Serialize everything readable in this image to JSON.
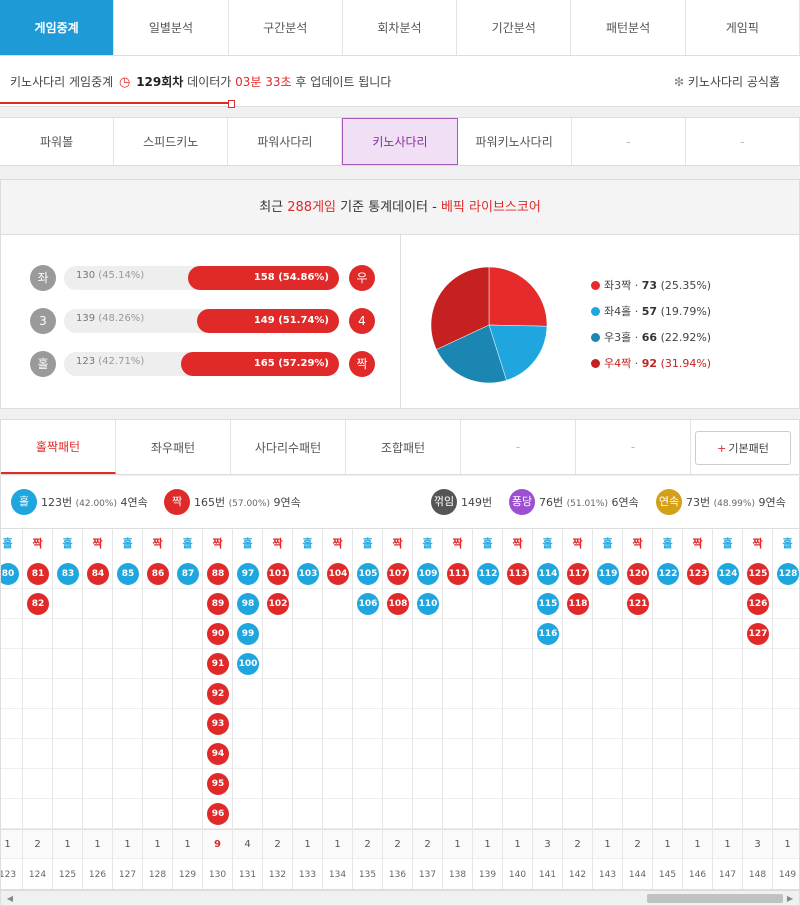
{
  "nav": {
    "tabs": [
      "게임중계",
      "일별분석",
      "구간분석",
      "회차분석",
      "기간분석",
      "패턴분석",
      "게임픽"
    ],
    "active": 0
  },
  "info": {
    "prefix": "키노사다리 게임중계",
    "round": "129회차",
    "mid": "데이터가",
    "time": "03분 33초",
    "suffix": "후 업데이트 됩니다",
    "official": "키노사다리 공식홈"
  },
  "games": {
    "tabs": [
      "파워볼",
      "스피드키노",
      "파워사다리",
      "키노사다리",
      "파워키노사다리",
      "-",
      "-"
    ],
    "active": 3
  },
  "stats": {
    "head_pre": "최근",
    "games": "288게임",
    "head_mid": "기준 통계데이터 -",
    "brand": "베픽 라이브스코어",
    "bars": [
      {
        "left": "좌",
        "right": "우",
        "left_val": "130",
        "left_pct": "(45.14%)",
        "right_text": "158 (54.86%)",
        "right_frac": 0.5486
      },
      {
        "left": "3",
        "right": "4",
        "left_val": "139",
        "left_pct": "(48.26%)",
        "right_text": "149 (51.74%)",
        "right_frac": 0.5174
      },
      {
        "left": "홀",
        "right": "짝",
        "left_val": "123",
        "left_pct": "(42.71%)",
        "right_text": "165 (57.29%)",
        "right_frac": 0.5729
      }
    ],
    "legend": [
      {
        "label": "좌3짝",
        "value": "73",
        "pct": "(25.35%)",
        "color": "#e52b2b"
      },
      {
        "label": "좌4홀",
        "value": "57",
        "pct": "(19.79%)",
        "color": "#1fa6df"
      },
      {
        "label": "우3홀",
        "value": "66",
        "pct": "(22.92%)",
        "color": "#1b86b2"
      },
      {
        "label": "우4짝",
        "value": "92",
        "pct": "(31.94%)",
        "color": "#c52121"
      }
    ]
  },
  "pattern": {
    "tabs": [
      "홀짝패턴",
      "좌우패턴",
      "사다리수패턴",
      "조합패턴",
      "-",
      "-"
    ],
    "active": 0,
    "button": "기본패턴",
    "button_plus": "+",
    "summary": [
      {
        "badge": "홀",
        "color": "#1fa6df",
        "count": "123번",
        "pct": "(42.00%)",
        "streak": "4연속"
      },
      {
        "badge": "짝",
        "color": "#e02a2a",
        "count": "165번",
        "pct": "(57.00%)",
        "streak": "9연속"
      },
      {
        "badge": "꺾임",
        "color": "#555555",
        "count": "149번",
        "pct": "",
        "streak": ""
      },
      {
        "badge": "퐁당",
        "color": "#9b4fd1",
        "count": "76번",
        "pct": "(51.01%)",
        "streak": "6연속"
      },
      {
        "badge": "연속",
        "color": "#d4a017",
        "count": "73번",
        "pct": "(48.99%)",
        "streak": "9연속"
      }
    ],
    "columns": [
      {
        "h": "홀",
        "t": "blue",
        "b": [
          "80"
        ],
        "n": "1",
        "r": "123"
      },
      {
        "h": "짝",
        "t": "red",
        "b": [
          "81",
          "82"
        ],
        "n": "2",
        "r": "124"
      },
      {
        "h": "홀",
        "t": "blue",
        "b": [
          "83"
        ],
        "n": "1",
        "r": "125"
      },
      {
        "h": "짝",
        "t": "red",
        "b": [
          "84"
        ],
        "n": "1",
        "r": "126"
      },
      {
        "h": "홀",
        "t": "blue",
        "b": [
          "85"
        ],
        "n": "1",
        "r": "127"
      },
      {
        "h": "짝",
        "t": "red",
        "b": [
          "86"
        ],
        "n": "1",
        "r": "128"
      },
      {
        "h": "홀",
        "t": "blue",
        "b": [
          "87"
        ],
        "n": "1",
        "r": "129"
      },
      {
        "h": "짝",
        "t": "red",
        "b": [
          "88",
          "89",
          "90",
          "91",
          "92",
          "93",
          "94",
          "95",
          "96"
        ],
        "n": "9",
        "r": "130"
      },
      {
        "h": "홀",
        "t": "blue",
        "b": [
          "97",
          "98",
          "99",
          "100"
        ],
        "n": "4",
        "r": "131"
      },
      {
        "h": "짝",
        "t": "red",
        "b": [
          "101",
          "102"
        ],
        "n": "2",
        "r": "132"
      },
      {
        "h": "홀",
        "t": "blue",
        "b": [
          "103"
        ],
        "n": "1",
        "r": "133"
      },
      {
        "h": "짝",
        "t": "red",
        "b": [
          "104"
        ],
        "n": "1",
        "r": "134"
      },
      {
        "h": "홀",
        "t": "blue",
        "b": [
          "105",
          "106"
        ],
        "n": "2",
        "r": "135"
      },
      {
        "h": "짝",
        "t": "red",
        "b": [
          "107",
          "108"
        ],
        "n": "2",
        "r": "136"
      },
      {
        "h": "홀",
        "t": "blue",
        "b": [
          "109",
          "110"
        ],
        "n": "2",
        "r": "137"
      },
      {
        "h": "짝",
        "t": "red",
        "b": [
          "111"
        ],
        "n": "1",
        "r": "138"
      },
      {
        "h": "홀",
        "t": "blue",
        "b": [
          "112"
        ],
        "n": "1",
        "r": "139"
      },
      {
        "h": "짝",
        "t": "red",
        "b": [
          "113"
        ],
        "n": "1",
        "r": "140"
      },
      {
        "h": "홀",
        "t": "blue",
        "b": [
          "114",
          "115",
          "116"
        ],
        "n": "3",
        "r": "141"
      },
      {
        "h": "짝",
        "t": "red",
        "b": [
          "117",
          "118"
        ],
        "n": "2",
        "r": "142"
      },
      {
        "h": "홀",
        "t": "blue",
        "b": [
          "119"
        ],
        "n": "1",
        "r": "143"
      },
      {
        "h": "짝",
        "t": "red",
        "b": [
          "120",
          "121"
        ],
        "n": "2",
        "r": "144"
      },
      {
        "h": "홀",
        "t": "blue",
        "b": [
          "122"
        ],
        "n": "1",
        "r": "145"
      },
      {
        "h": "짝",
        "t": "red",
        "b": [
          "123"
        ],
        "n": "1",
        "r": "146"
      },
      {
        "h": "홀",
        "t": "blue",
        "b": [
          "124"
        ],
        "n": "1",
        "r": "147"
      },
      {
        "h": "짝",
        "t": "red",
        "b": [
          "125",
          "126",
          "127"
        ],
        "n": "3",
        "r": "148"
      },
      {
        "h": "홀",
        "t": "blue",
        "b": [
          "128"
        ],
        "n": "1",
        "r": "149"
      }
    ]
  }
}
